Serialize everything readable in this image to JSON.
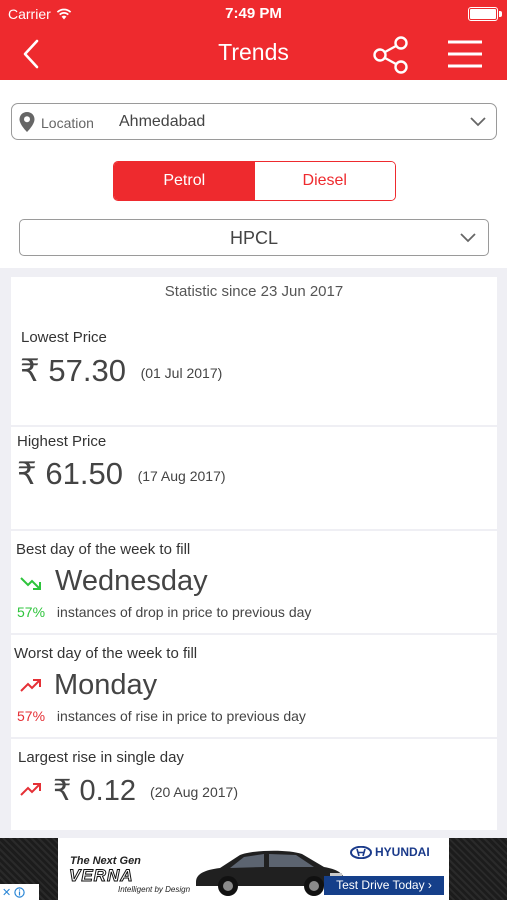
{
  "status_bar": {
    "carrier": "Carrier",
    "time": "7:49 PM"
  },
  "nav": {
    "title": "Trends"
  },
  "location": {
    "label": "Location",
    "value": "Ahmedabad"
  },
  "fuel_toggle": {
    "selected": "Petrol",
    "options": [
      "Petrol",
      "Diesel"
    ]
  },
  "company": {
    "value": "HPCL"
  },
  "stats": {
    "since": "Statistic since 23 Jun 2017",
    "lowest": {
      "label": "Lowest Price",
      "currency": "₹",
      "value": "57.30",
      "date": "(01 Jul 2017)"
    },
    "highest": {
      "label": "Highest Price",
      "currency": "₹",
      "value": "61.50",
      "date": "(17 Aug 2017)"
    },
    "best_day": {
      "label": "Best day of the week to fill",
      "value": "Wednesday",
      "pct": "57%",
      "desc": "instances of drop in price to previous day"
    },
    "worst_day": {
      "label": "Worst day of the week to fill",
      "value": "Monday",
      "pct": "57%",
      "desc": "instances of rise in price to previous day"
    },
    "largest_rise": {
      "label": "Largest rise in single day",
      "currency": "₹",
      "value": "0.12",
      "date": "(20 Aug 2017)"
    }
  },
  "ad": {
    "tagline": "The Next Gen",
    "model": "VERNA",
    "sub": "Intelligent by Design",
    "brand": "HYUNDAI",
    "cta": "Test Drive Today ›"
  },
  "colors": {
    "accent": "#ee2a2e",
    "drop": "#2ec43c",
    "rise": "#e53036",
    "background": "#efeff4"
  }
}
